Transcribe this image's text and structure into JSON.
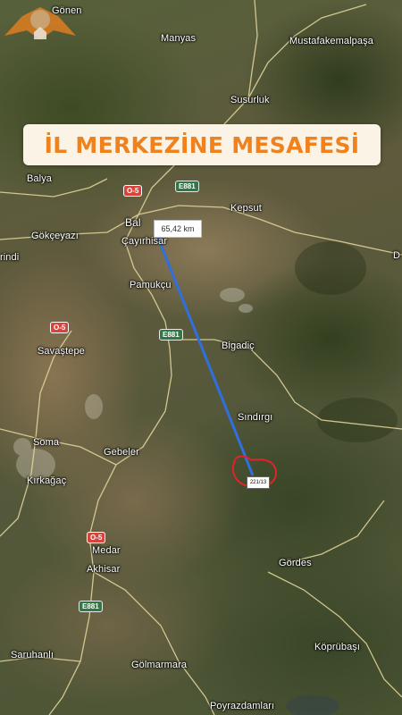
{
  "title": "İL MERKEZİNE MESAFESİ",
  "distance_label": "65,42 km",
  "parcel_tag": "221/13",
  "places": {
    "gonen": "Gönen",
    "manyas": "Manyas",
    "mustafakemalpasa": "Mustafakemalpaşa",
    "susurluk": "Susurluk",
    "balya": "Balya",
    "kepsut": "Kepsut",
    "balikesir": "Bal",
    "gokceyazi": "Gökçeyazı",
    "cayirhisar": "Çayırhisar",
    "dursunbey": "D",
    "irindi": "rindi",
    "pamukcu": "Pamukçu",
    "bigadic": "Bigadiç",
    "savastepe": "Savaştepe",
    "sindirgi": "Sındırgı",
    "soma": "Soma",
    "gebeler": "Gebeler",
    "kirkagac": "Kırkağaç",
    "medar": "Medar",
    "akhisar": "Akhisar",
    "gordes": "Gördes",
    "saruhanli": "Saruhanlı",
    "kopruabasi": "Köprübaşı",
    "golmarmara": "Gölmarmara",
    "poyrazdamlari": "Poyrazdamları"
  },
  "road_shields": {
    "o5_top": "O-5",
    "e881_top": "E881",
    "o5_mid": "O-5",
    "e881_mid": "E881",
    "o5_low": "O-5",
    "e881_low": "E881"
  },
  "colors": {
    "banner_text": "#f0821e",
    "banner_bg": "#fbf4e6",
    "measure_line": "#2f6fe0",
    "parcel_outline": "#e0242a",
    "road": "#e8d9a0"
  }
}
